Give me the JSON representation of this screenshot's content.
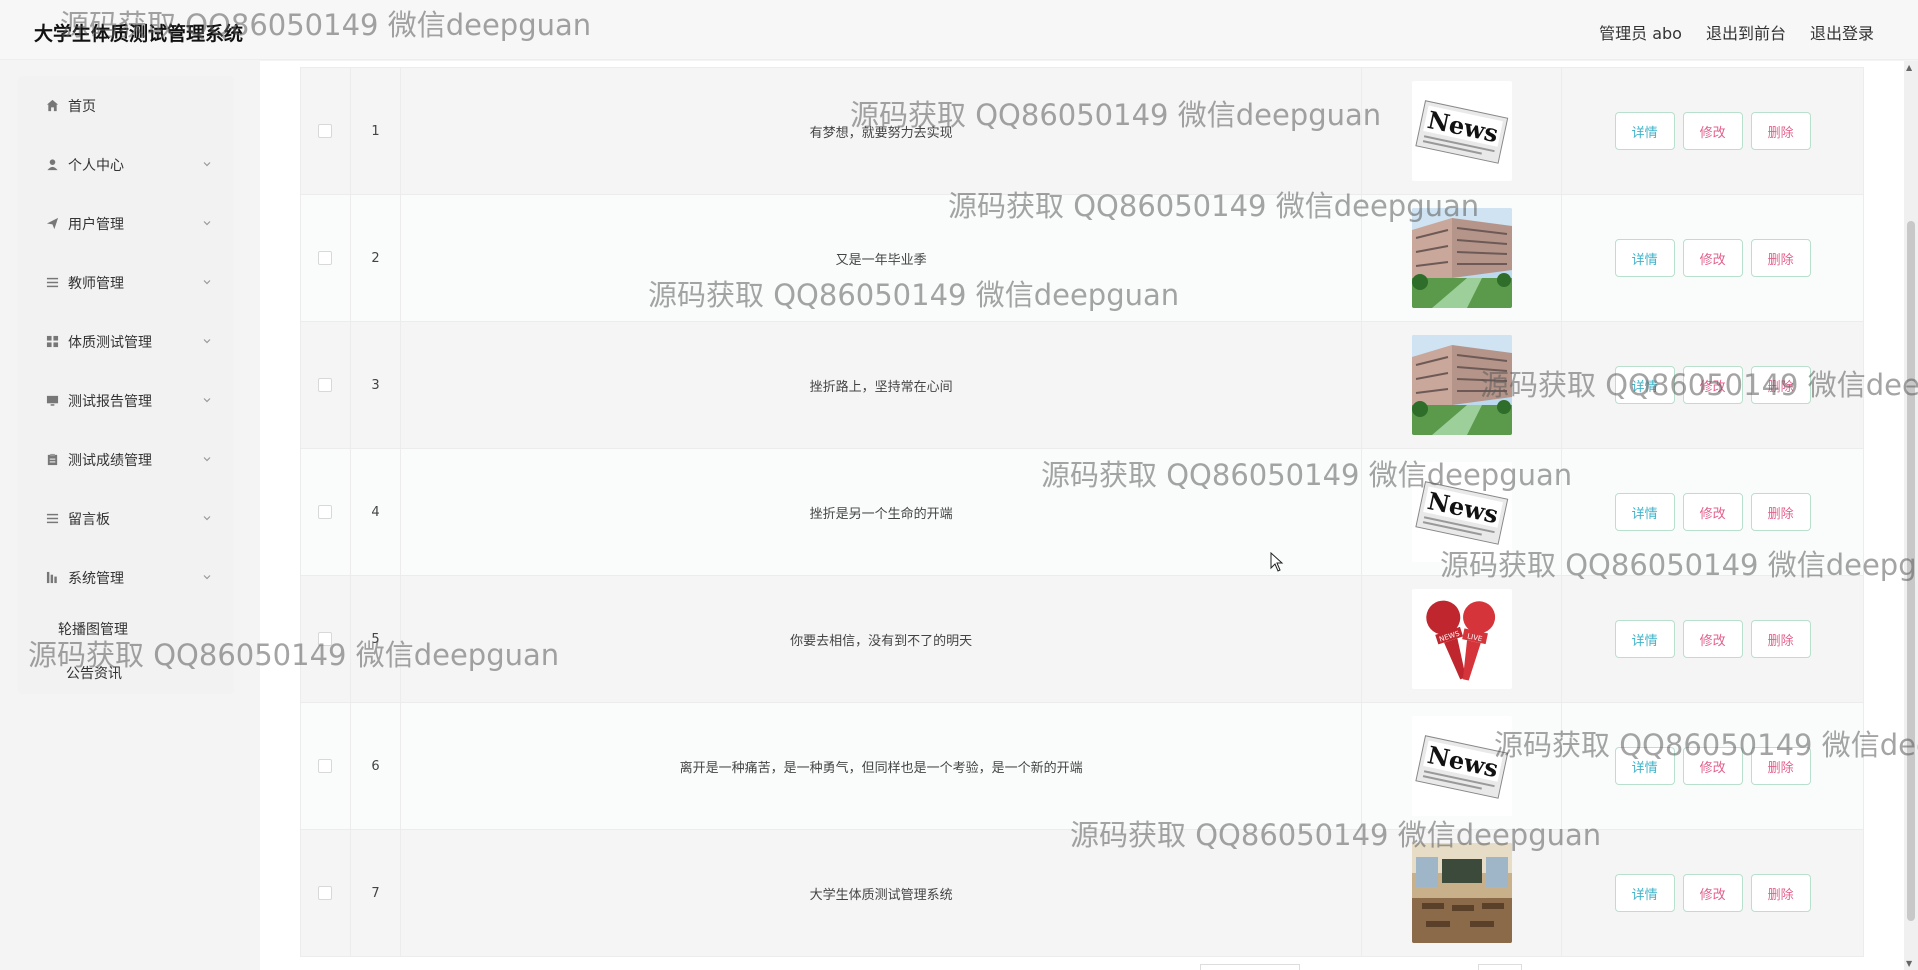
{
  "header": {
    "title": "大学生体质测试管理系统",
    "links": [
      "管理员 abo",
      "退出到前台",
      "退出登录"
    ]
  },
  "sidebar": {
    "items": [
      {
        "label": "首页",
        "icon": "home-icon",
        "has_children": false
      },
      {
        "label": "个人中心",
        "icon": "user-icon",
        "has_children": true
      },
      {
        "label": "用户管理",
        "icon": "send-icon",
        "has_children": true
      },
      {
        "label": "教师管理",
        "icon": "list-icon",
        "has_children": true
      },
      {
        "label": "体质测试管理",
        "icon": "grid-icon",
        "has_children": true
      },
      {
        "label": "测试报告管理",
        "icon": "monitor-icon",
        "has_children": true
      },
      {
        "label": "测试成绩管理",
        "icon": "clipboard-icon",
        "has_children": true
      },
      {
        "label": "留言板",
        "icon": "list-icon",
        "has_children": true
      },
      {
        "label": "系统管理",
        "icon": "chart-icon",
        "has_children": true
      }
    ],
    "subitems": [
      "轮播图管理",
      "公告资讯"
    ]
  },
  "table": {
    "rows": [
      {
        "num": "1",
        "title": "有梦想，就要努力去实现",
        "image": "news"
      },
      {
        "num": "2",
        "title": "又是一年毕业季",
        "image": "campus"
      },
      {
        "num": "3",
        "title": "挫折路上，坚持常在心间",
        "image": "campus"
      },
      {
        "num": "4",
        "title": "挫折是另一个生命的开端",
        "image": "news"
      },
      {
        "num": "5",
        "title": "你要去相信，没有到不了的明天",
        "image": "microphone"
      },
      {
        "num": "6",
        "title": "离开是一种痛苦，是一种勇气，但同样也是一个考验，是一个新的开端",
        "image": "news"
      },
      {
        "num": "7",
        "title": "大学生体质测试管理系统",
        "image": "classroom"
      }
    ],
    "actions": {
      "detail": "详情",
      "edit": "修改",
      "delete": "删除"
    }
  },
  "watermark": "源码获取 QQ86050149 微信deepguan",
  "colors": {
    "detail": "#41b3c9",
    "edit": "#e3618d",
    "delete": "#e3618d",
    "border": "#b8e0cc"
  }
}
